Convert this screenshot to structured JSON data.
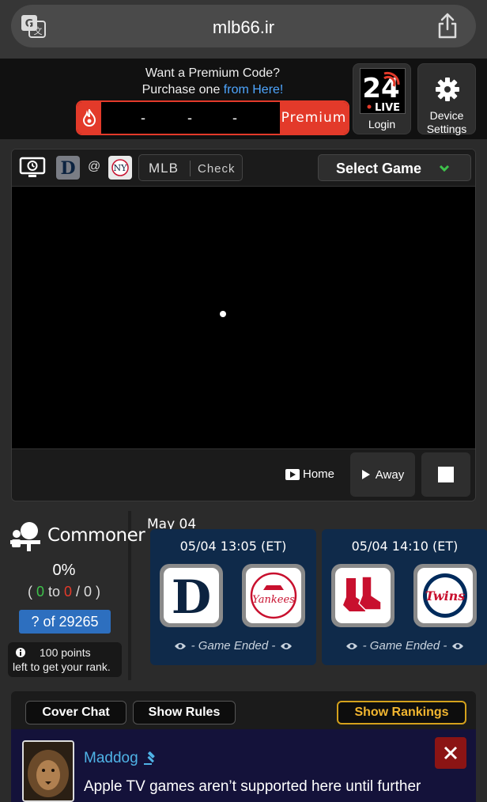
{
  "browser": {
    "url": "mlb66.ir"
  },
  "premium": {
    "line1": "Want a Premium Code?",
    "line2_prefix": "Purchase one ",
    "line2_link": "from Here!",
    "code_placeholder": [
      "-",
      "-",
      "-"
    ],
    "button_label": "Premium"
  },
  "header_buttons": {
    "login_label": "Login",
    "live_badge": "LIVE",
    "live_number": "24",
    "settings_label_1": "Device",
    "settings_label_2": "Settings"
  },
  "player": {
    "at": "@",
    "league": "MLB",
    "check_label": "Check",
    "select_game_label": "Select Game",
    "home_label": "Home",
    "away_label": "Away"
  },
  "rank": {
    "title": "Commoner",
    "percent": "0%",
    "score_open": "( ",
    "score_green": "0",
    "score_to": " to ",
    "score_red": "0",
    "score_sep": " / ",
    "score_total": "0",
    "score_close": " )",
    "position": "? of 29265",
    "note_line1": "100 points",
    "note_line2": "left to get your rank."
  },
  "games": {
    "date": "May 04",
    "items": [
      {
        "time": "05/04 13:05 (ET)",
        "status": "- Game Ended -",
        "home": "Detroit Tigers",
        "away": "New York Yankees"
      },
      {
        "time": "05/04 14:10 (ET)",
        "status": "- Game Ended -",
        "home": "Boston Red Sox",
        "away": "Minnesota Twins"
      }
    ]
  },
  "chat": {
    "cover_chat_label": "Cover Chat",
    "show_rules_label": "Show Rules",
    "show_rankings_label": "Show Rankings",
    "username": "Maddog",
    "message": "Apple TV games aren’t supported here until further"
  },
  "colors": {
    "accent_red": "#e33a2a",
    "link_blue": "#4ea6ff",
    "gold": "#f2b630",
    "card_navy": "#0f2a4a"
  }
}
